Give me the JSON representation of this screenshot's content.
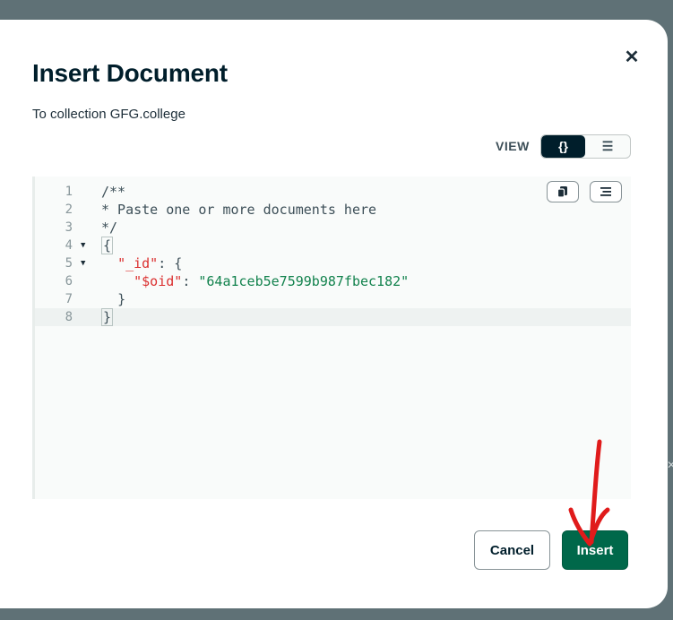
{
  "dialog": {
    "title": "Insert Document",
    "subtitle": "To collection GFG.college",
    "close_icon": "close-icon"
  },
  "view": {
    "label": "VIEW",
    "options": [
      {
        "label": "{}",
        "icon": "braces-icon",
        "selected": true
      },
      {
        "label": "☰",
        "icon": "list-icon",
        "selected": false
      }
    ]
  },
  "editor": {
    "toolbar": {
      "copy_icon": "copy-icon",
      "format_icon": "format-icon"
    },
    "lines": [
      {
        "number": "1",
        "fold": false,
        "text": "/**"
      },
      {
        "number": "2",
        "fold": false,
        "text": "* Paste one or more documents here"
      },
      {
        "number": "3",
        "fold": false,
        "text": "*/"
      },
      {
        "number": "4",
        "fold": true,
        "text": "{"
      },
      {
        "number": "5",
        "fold": true,
        "text": "  \"_id\": {"
      },
      {
        "number": "6",
        "fold": false,
        "text": "    \"$oid\": \"64a1ceb5e7599b987fbec182\""
      },
      {
        "number": "7",
        "fold": false,
        "text": "  }"
      },
      {
        "number": "8",
        "fold": false,
        "text": "}"
      }
    ],
    "tokens": {
      "comment_open": "/**",
      "comment_body": "* Paste one or more documents here",
      "comment_close": "*/",
      "brace_open": "{",
      "id_key": "\"_id\"",
      "colon_brace": ": {",
      "oid_key": "\"$oid\"",
      "colon": ": ",
      "oid_value": "\"64a1ceb5e7599b987fbec182\"",
      "inner_close": "}",
      "brace_close": "}"
    }
  },
  "actions": {
    "cancel_label": "Cancel",
    "insert_label": "Insert"
  },
  "colors": {
    "primary": "#00684a",
    "title": "#001e2b",
    "json_key": "#db3030",
    "json_string": "#12824d",
    "annotation_arrow": "#e01b1b"
  }
}
